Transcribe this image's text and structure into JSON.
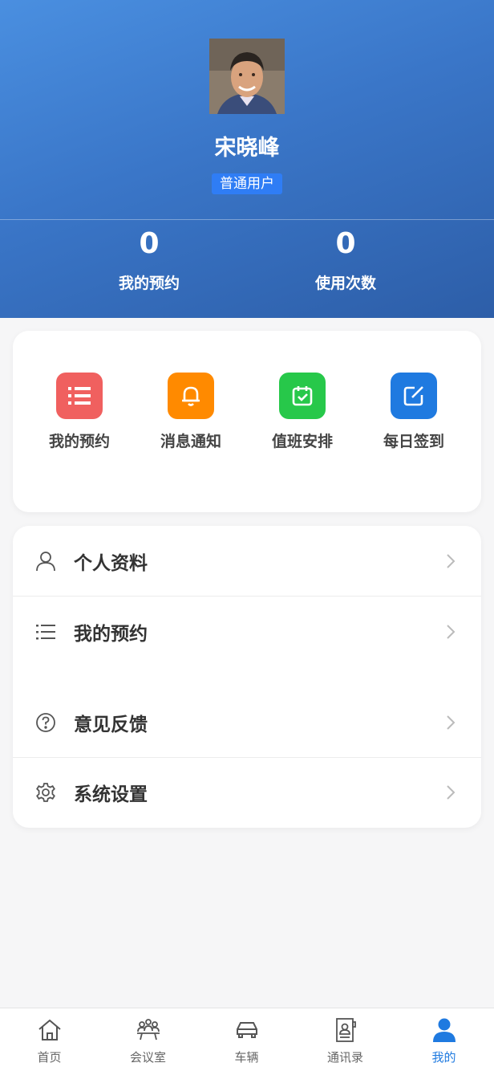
{
  "profile": {
    "name": "宋晓峰",
    "role": "普通用户"
  },
  "stats": [
    {
      "value": "0",
      "label": "我的预约"
    },
    {
      "value": "0",
      "label": "使用次数"
    }
  ],
  "quick_actions": [
    {
      "label": "我的预约",
      "icon": "list-icon",
      "color": "#f0605f"
    },
    {
      "label": "消息通知",
      "icon": "bell-icon",
      "color": "#ff8a00"
    },
    {
      "label": "值班安排",
      "icon": "calendar-check-icon",
      "color": "#27c84a"
    },
    {
      "label": "每日签到",
      "icon": "edit-icon",
      "color": "#1f7ae0"
    }
  ],
  "menu": [
    {
      "label": "个人资料",
      "icon": "user-icon"
    },
    {
      "label": "我的预约",
      "icon": "list-icon"
    },
    {
      "label": "意见反馈",
      "icon": "question-icon"
    },
    {
      "label": "系统设置",
      "icon": "gear-icon"
    }
  ],
  "tabbar": [
    {
      "label": "首页",
      "icon": "home-icon"
    },
    {
      "label": "会议室",
      "icon": "meeting-room-icon"
    },
    {
      "label": "车辆",
      "icon": "car-icon"
    },
    {
      "label": "通讯录",
      "icon": "contacts-icon"
    },
    {
      "label": "我的",
      "icon": "person-icon",
      "active": true
    }
  ],
  "colors": {
    "header_top": "#4a8fe0",
    "header_bottom": "#2d5ea8",
    "badge": "#2f7df5",
    "active_tab": "#1f7ae0"
  }
}
